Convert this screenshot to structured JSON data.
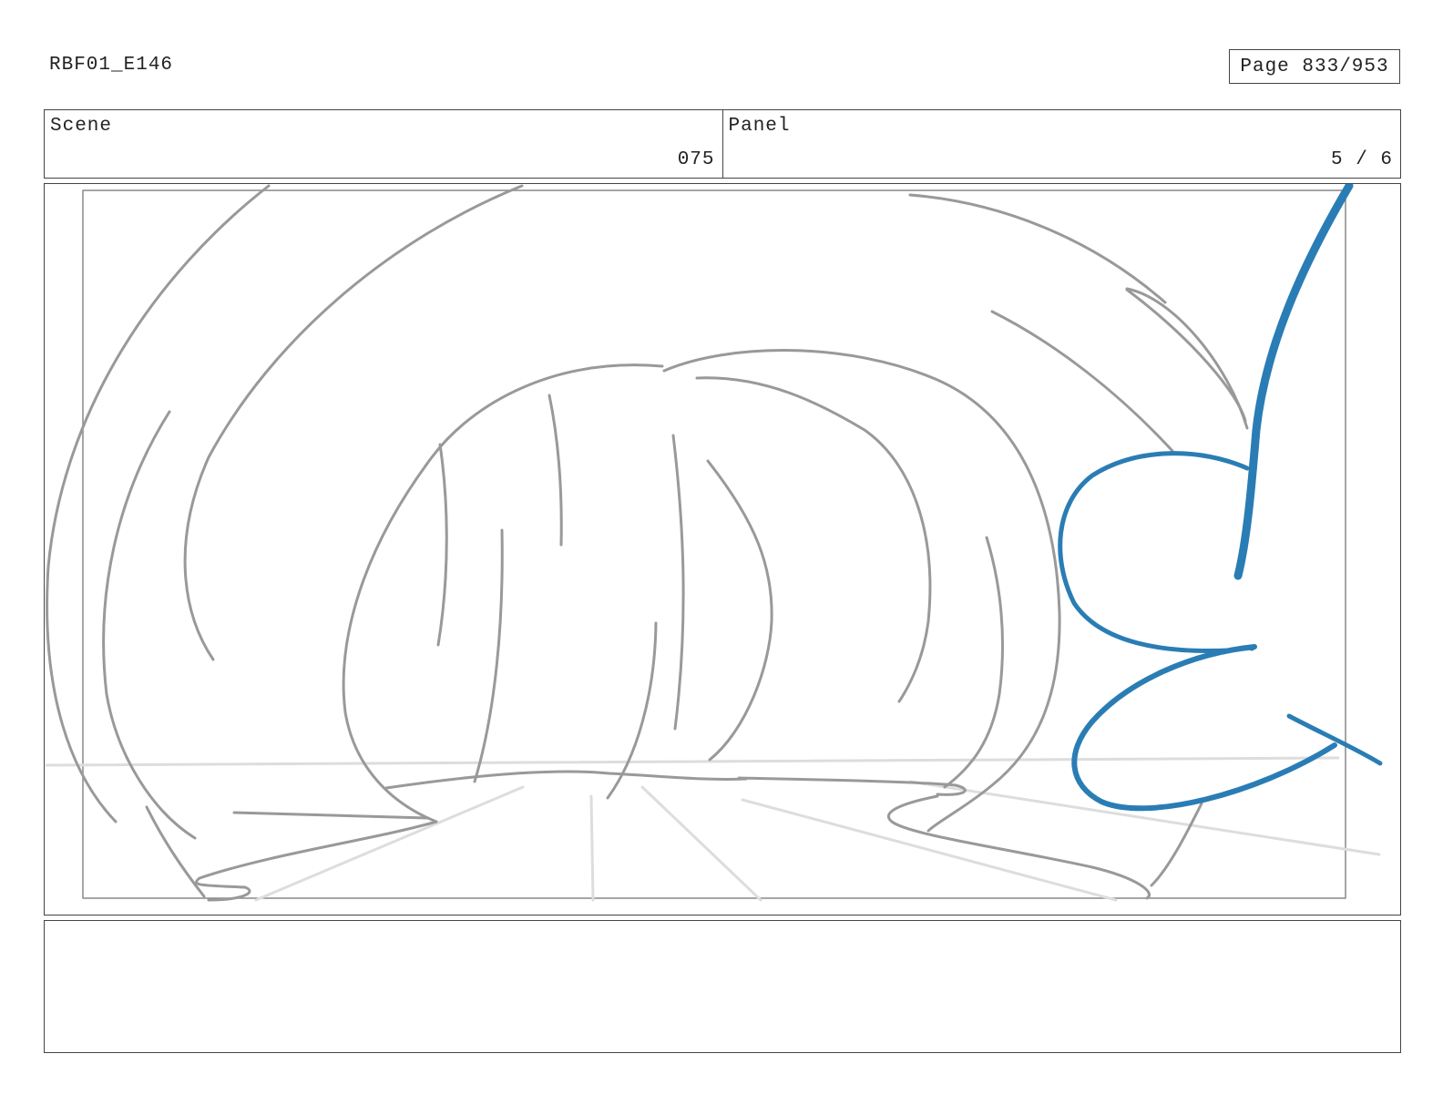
{
  "header": {
    "doc_id": "RBF01_E146",
    "page_label": "Page 833/953"
  },
  "scene": {
    "label": "Scene",
    "value": "075"
  },
  "panel": {
    "label": "Panel",
    "value": "5 / 6"
  },
  "sketch": {
    "line_color": "#999999",
    "horizon_color": "#dddddd",
    "accent_color": "#2a7db4"
  },
  "notes": {
    "text": ""
  }
}
